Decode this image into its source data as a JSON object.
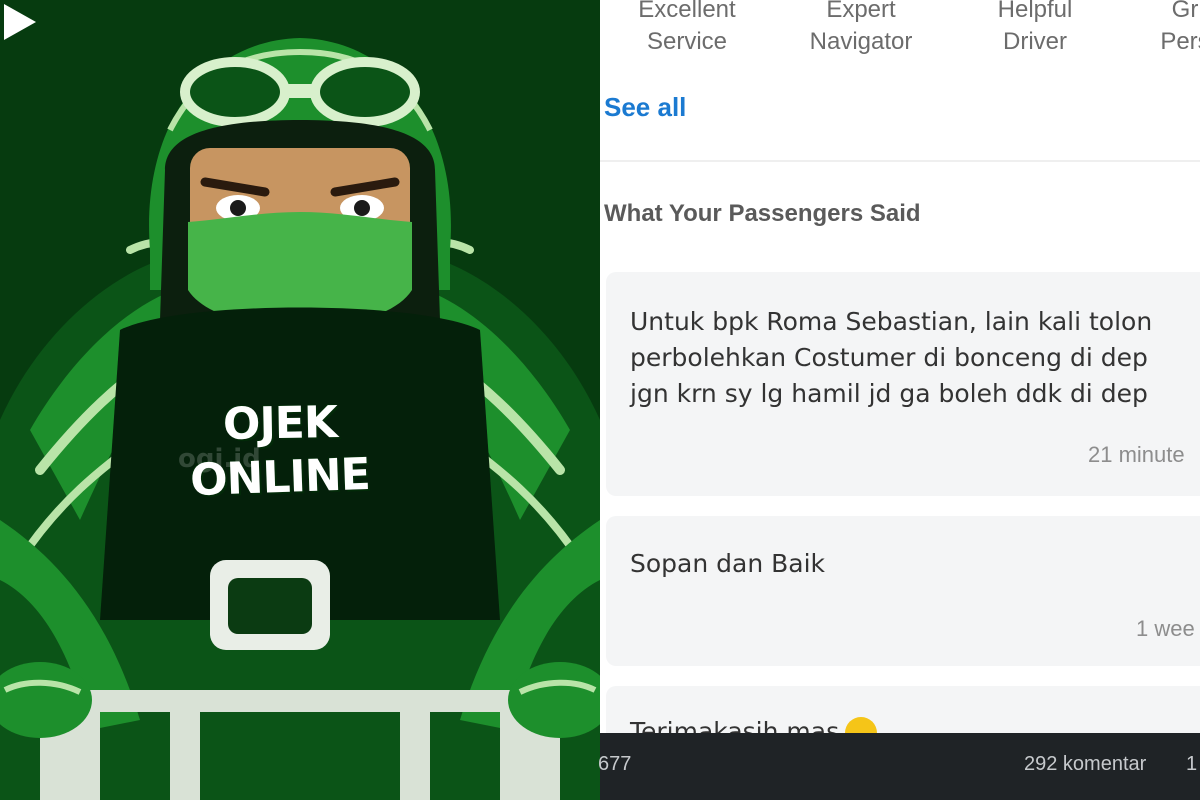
{
  "left_panel": {
    "shirt_line1": "OJEK",
    "shirt_line2": "ONLINE",
    "watermark": "ogi.id",
    "icons": [
      "play-icon",
      "rider-illustration"
    ]
  },
  "right_panel": {
    "badges": [
      "Excellent\nService",
      "Expert\nNavigator",
      "Helpful\nDriver",
      "Gr\nPers"
    ],
    "see_all": "See all",
    "section_title": "What Your Passengers Said",
    "reviews": [
      {
        "text": "Untuk bpk Roma Sebastian, lain kali tolon\nperbolehkan Costumer di bonceng di dep\njgn krn sy lg hamil jd ga boleh ddk di dep",
        "time": "21 minute"
      },
      {
        "text": "Sopan dan Baik",
        "time": "1 wee"
      },
      {
        "text": "Terimakasih mas",
        "time": ""
      }
    ]
  },
  "bottom_bar": {
    "left_count": "677",
    "comments": "292 komentar",
    "right_count": "1"
  },
  "colors": {
    "bg_dark_green": "#063b0f",
    "helmet_green": "#1d8f2c",
    "mask_green": "#46b449",
    "link_blue": "#1b7ad1",
    "card_bg": "#f4f5f6",
    "bottom_bar": "#1f2326"
  }
}
